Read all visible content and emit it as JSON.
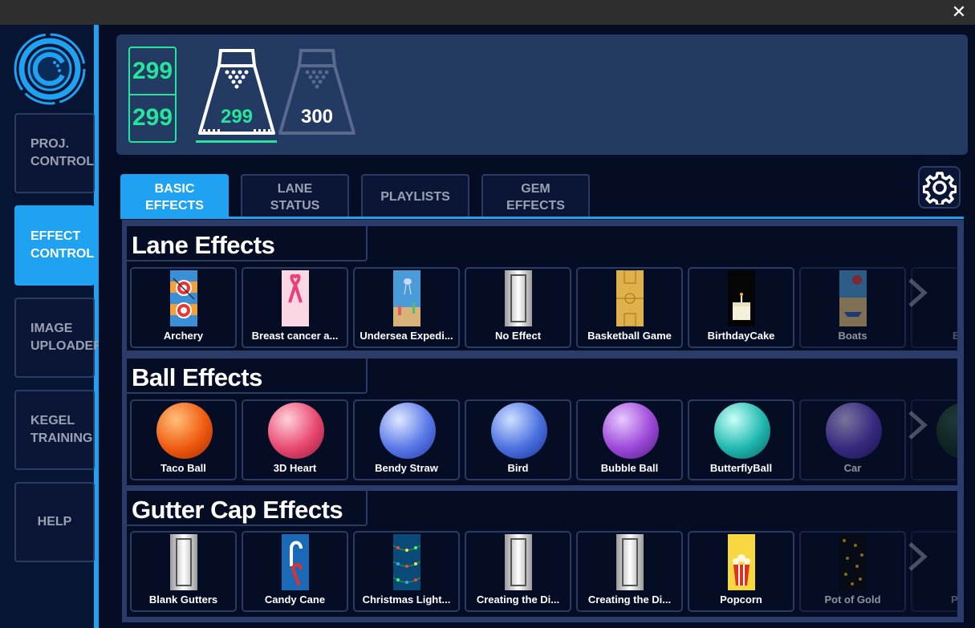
{
  "window": {
    "close_glyph": "✕"
  },
  "sidebar": {
    "items": [
      {
        "label": "PROJ.\nCONTROL",
        "active": false
      },
      {
        "label": "EFFECT\nCONTROL",
        "active": true
      },
      {
        "label": "IMAGE\nUPLOADER",
        "active": false
      },
      {
        "label": "KEGEL\nTRAINING",
        "active": false
      },
      {
        "label": "HELP",
        "active": false
      }
    ]
  },
  "header": {
    "score_top": "299",
    "score_bottom": "299",
    "lanes": [
      {
        "number": "299",
        "selected": true
      },
      {
        "number": "300",
        "selected": false
      }
    ]
  },
  "tabs": [
    {
      "label": "BASIC\nEFFECTS",
      "active": true
    },
    {
      "label": "LANE\nSTATUS",
      "active": false
    },
    {
      "label": "PLAYLISTS",
      "active": false
    },
    {
      "label": "GEM\nEFFECTS",
      "active": false
    }
  ],
  "sections": {
    "lane_effects": {
      "title": "Lane Effects",
      "items": [
        "Archery",
        "Breast cancer a...",
        "Undersea Expedi...",
        "No Effect",
        "Basketball Game",
        "BirthdayCake",
        "Boats",
        "Bri..."
      ]
    },
    "ball_effects": {
      "title": "Ball Effects",
      "items": [
        "Taco Ball",
        "3D Heart",
        "Bendy Straw",
        "Bird",
        "Bubble Ball",
        "ButterflyBall",
        "Car"
      ]
    },
    "gutter_cap_effects": {
      "title": "Gutter Cap Effects",
      "items": [
        "Blank Gutters",
        "Candy Cane",
        "Christmas Light...",
        "Creating the Di...",
        "Creating the Di...",
        "Popcorn",
        "Pot of Gold",
        "Pav..."
      ]
    }
  },
  "colors": {
    "accent": "#1fa2f1",
    "score_green": "#27e39b",
    "panel": "#233a63",
    "background": "#050d24"
  },
  "icons": [
    "app-logo-icon",
    "close-icon",
    "pin-deck-icon",
    "gear-icon",
    "chevron-right-icon"
  ]
}
